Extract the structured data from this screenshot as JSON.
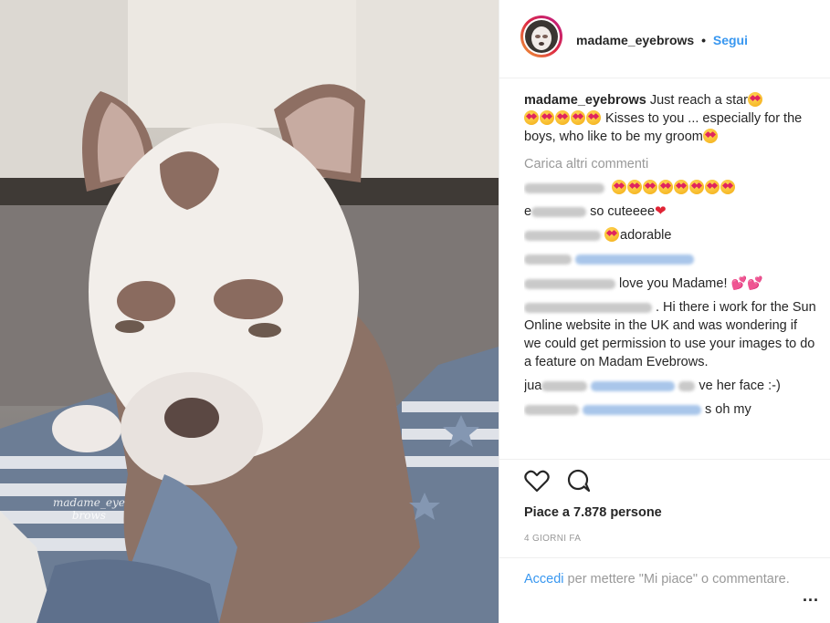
{
  "post": {
    "username": "madame_eyebrows",
    "separator": "•",
    "follow_label": "Segui",
    "caption_text": " Just reach a star",
    "caption_text2": " Kisses to you ... especially for the boys, who like to be my groom",
    "load_more": "Carica altri commenti",
    "watermark_line1": "madame_eye",
    "watermark_line2": "brows"
  },
  "comments": [
    {
      "user_prefix": "",
      "text": ""
    },
    {
      "user_prefix": "e",
      "text": "so cuteeee"
    },
    {
      "user_prefix": "",
      "text": "adorable"
    },
    {
      "user_prefix": "",
      "text": ""
    },
    {
      "user_prefix": "",
      "text": "love you Madame! "
    },
    {
      "user_prefix": "",
      "text": ". Hi there i work for the Sun Online website in the UK and was wondering if we could get permission to use your images to do a feature on Madam Evebrows."
    },
    {
      "user_prefix": "jua",
      "text": "ve her face :-)"
    },
    {
      "user_prefix": "",
      "text": "s oh my"
    }
  ],
  "footer": {
    "likes": "Piace a 7.878 persone",
    "time": "4 GIORNI FA",
    "login_link": "Accedi",
    "login_rest": " per mettere \"Mi piace\" o commentare.",
    "more": "..."
  },
  "icons": {
    "like": "heart-outline-icon",
    "comment": "comment-bubble-icon",
    "more": "more-dots-icon"
  },
  "colors": {
    "link": "#3897f0",
    "muted": "#999999",
    "text": "#262626"
  }
}
